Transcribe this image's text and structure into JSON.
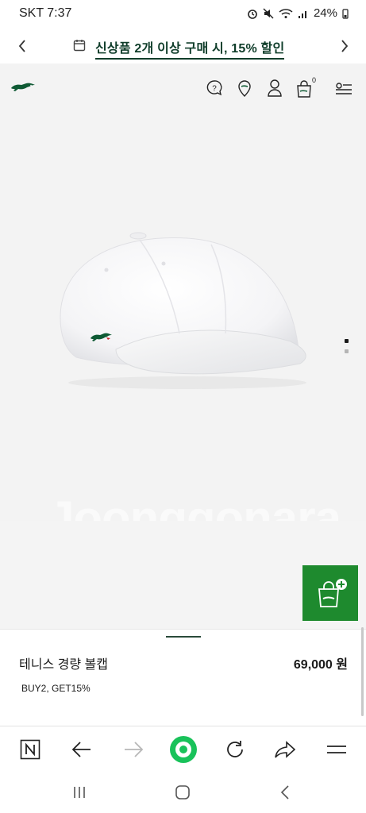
{
  "status_bar": {
    "time": "SKT 7:37",
    "battery": "24%"
  },
  "promo_bar": {
    "text": "신상품 2개 이상 구매 시, 15% 할인"
  },
  "header": {
    "logo": "lacoste-crocodile-logo",
    "icons": [
      "help-icon",
      "location-icon",
      "account-icon",
      "bag-icon",
      "menu-icon"
    ],
    "bag_count": "0"
  },
  "product_image": {
    "watermark": "Joonggonara",
    "carousel_dots": 2
  },
  "product": {
    "name": "테니스 경량 볼캡",
    "price": "69,000 원",
    "promo_code": "BUY2, GET15%"
  },
  "colors": {
    "brand_green": "#0f3d2a",
    "add_button_green": "#1e8a2e",
    "background_grey": "#f3f3f3"
  }
}
